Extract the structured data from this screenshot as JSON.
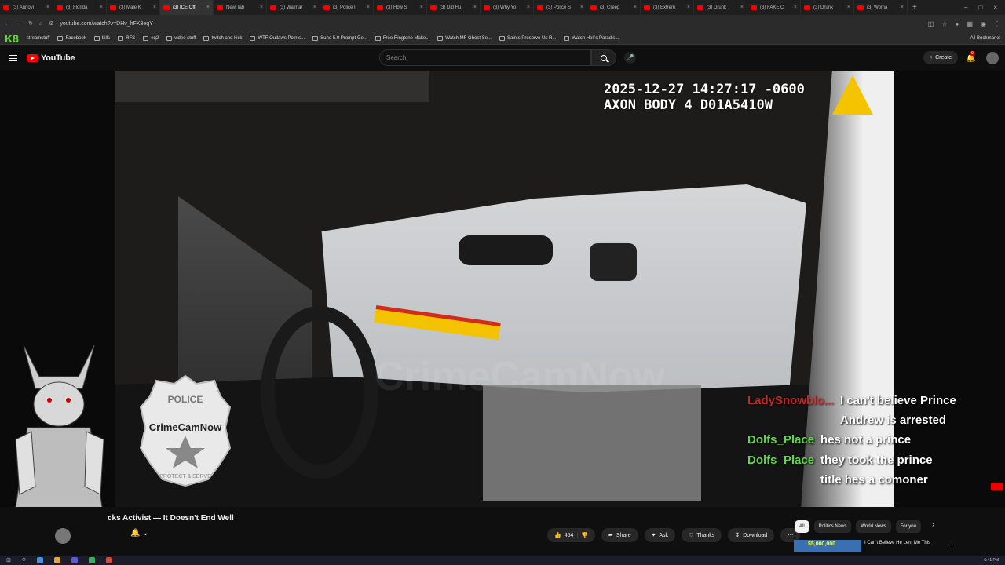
{
  "browser": {
    "tabs": [
      {
        "label": "(3) Annoyi",
        "active": false
      },
      {
        "label": "(3) Florida",
        "active": false
      },
      {
        "label": "(3) Male K",
        "active": false
      },
      {
        "label": "(3) ICE Offi",
        "active": true
      },
      {
        "label": "New Tab",
        "active": false
      },
      {
        "label": "(3) Walmar",
        "active": false
      },
      {
        "label": "(3) Police I",
        "active": false
      },
      {
        "label": "(3) How S",
        "active": false
      },
      {
        "label": "(3) Did Hu",
        "active": false
      },
      {
        "label": "(3) Why Yo",
        "active": false
      },
      {
        "label": "(3) Police S",
        "active": false
      },
      {
        "label": "(3) Creep",
        "active": false
      },
      {
        "label": "(3) Extrem",
        "active": false
      },
      {
        "label": "(3) Drunk",
        "active": false
      },
      {
        "label": "(3) FAKE C",
        "active": false
      },
      {
        "label": "(3) Drunk",
        "active": false
      },
      {
        "label": "(3) Woma",
        "active": false
      }
    ],
    "url": "youtube.com/watch?v=DHv_hFK3eqY",
    "bookmarks": [
      {
        "label": "Facebook"
      },
      {
        "label": "bills"
      },
      {
        "label": "RFS"
      },
      {
        "label": "eq2"
      },
      {
        "label": "video stuff"
      },
      {
        "label": "twitch and kick"
      },
      {
        "label": "WTF Outlaws Points..."
      },
      {
        "label": "Suno 5.0 Prompt Ge..."
      },
      {
        "label": "Free Ringtone Make..."
      },
      {
        "label": "Watch MF Ghost Se..."
      },
      {
        "label": "Saints Preserve Us R..."
      },
      {
        "label": "Watch Hell's Paradis..."
      }
    ],
    "bookmarks_all": "All Bookmarks",
    "k8_label": "K8",
    "streamstuff": "streamstuff"
  },
  "youtube": {
    "logo": "YouTube",
    "search_placeholder": "Search",
    "create_label": "Create",
    "notification_count": "9"
  },
  "video": {
    "timestamp_line1": "2025-12-27 14:27:17 -0600",
    "timestamp_line2": "AXON BODY 4 D01A5410W",
    "watermark": "CrimeCamNow",
    "badge_top": "POLICE",
    "badge_name": "CrimeCamNow",
    "badge_bottom": "PROTECT & SERVE"
  },
  "chat": [
    {
      "user": "LadySnowblo...",
      "message": "I can't believe Prince Andrew is arrested",
      "user_color": "#e02b2b"
    },
    {
      "user": "Dolfs_Place",
      "message": "hes not a prince",
      "user_color": "#5fd84a"
    },
    {
      "user": "Dolfs_Place",
      "message": "they took the prince title hes a comoner",
      "user_color": "#5fd84a"
    }
  ],
  "below_video": {
    "title": "cks Activist — It Doesn't End Well",
    "likes": "454",
    "share": "Share",
    "ask": "Ask",
    "thanks": "Thanks",
    "download": "Download",
    "chips": [
      "All",
      "Politics News",
      "World News",
      "For you"
    ],
    "rec_thumb_text": "$5,000,000",
    "rec_title": "I Can't Believe He Lent Me This"
  },
  "taskbar": {
    "time": "6:41 PM"
  },
  "colors": {
    "accent_red": "#ff0000",
    "chat_green": "#5fd84a",
    "chat_red": "#e02b2b"
  }
}
